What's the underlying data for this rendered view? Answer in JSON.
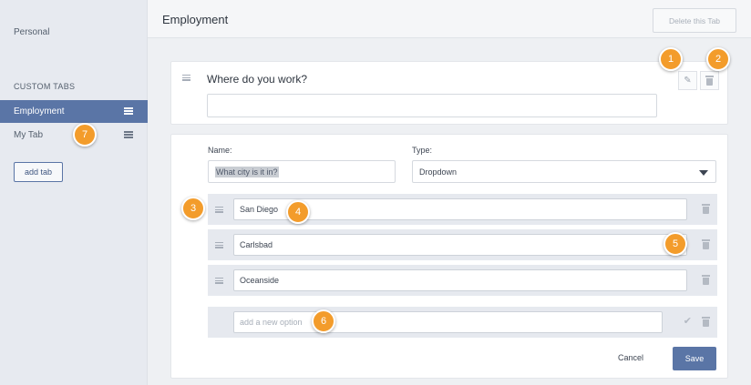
{
  "sidebar": {
    "personal": "Personal",
    "custom_tabs_heading": "CUSTOM TABS",
    "items": [
      {
        "label": "Employment",
        "active": true
      },
      {
        "label": "My Tab",
        "active": false
      }
    ],
    "add_tab": "add tab"
  },
  "header": {
    "title": "Employment",
    "delete_tab": "Delete this Tab"
  },
  "question_card": {
    "question": "Where do you work?",
    "answer_value": "",
    "edit_icon": "pencil-icon",
    "delete_icon": "trash-icon"
  },
  "edit_card": {
    "name_label": "Name:",
    "name_value": "What city is it in?",
    "type_label": "Type:",
    "type_value": "Dropdown",
    "options": [
      "San Diego",
      "Carlsbad",
      "Oceanside"
    ],
    "new_option_placeholder": "add a new option",
    "cancel": "Cancel",
    "save": "Save"
  },
  "callouts": [
    "1",
    "2",
    "3",
    "4",
    "5",
    "6",
    "7"
  ],
  "colors": {
    "accent": "#5a75a6",
    "callout": "#f39c2b"
  }
}
